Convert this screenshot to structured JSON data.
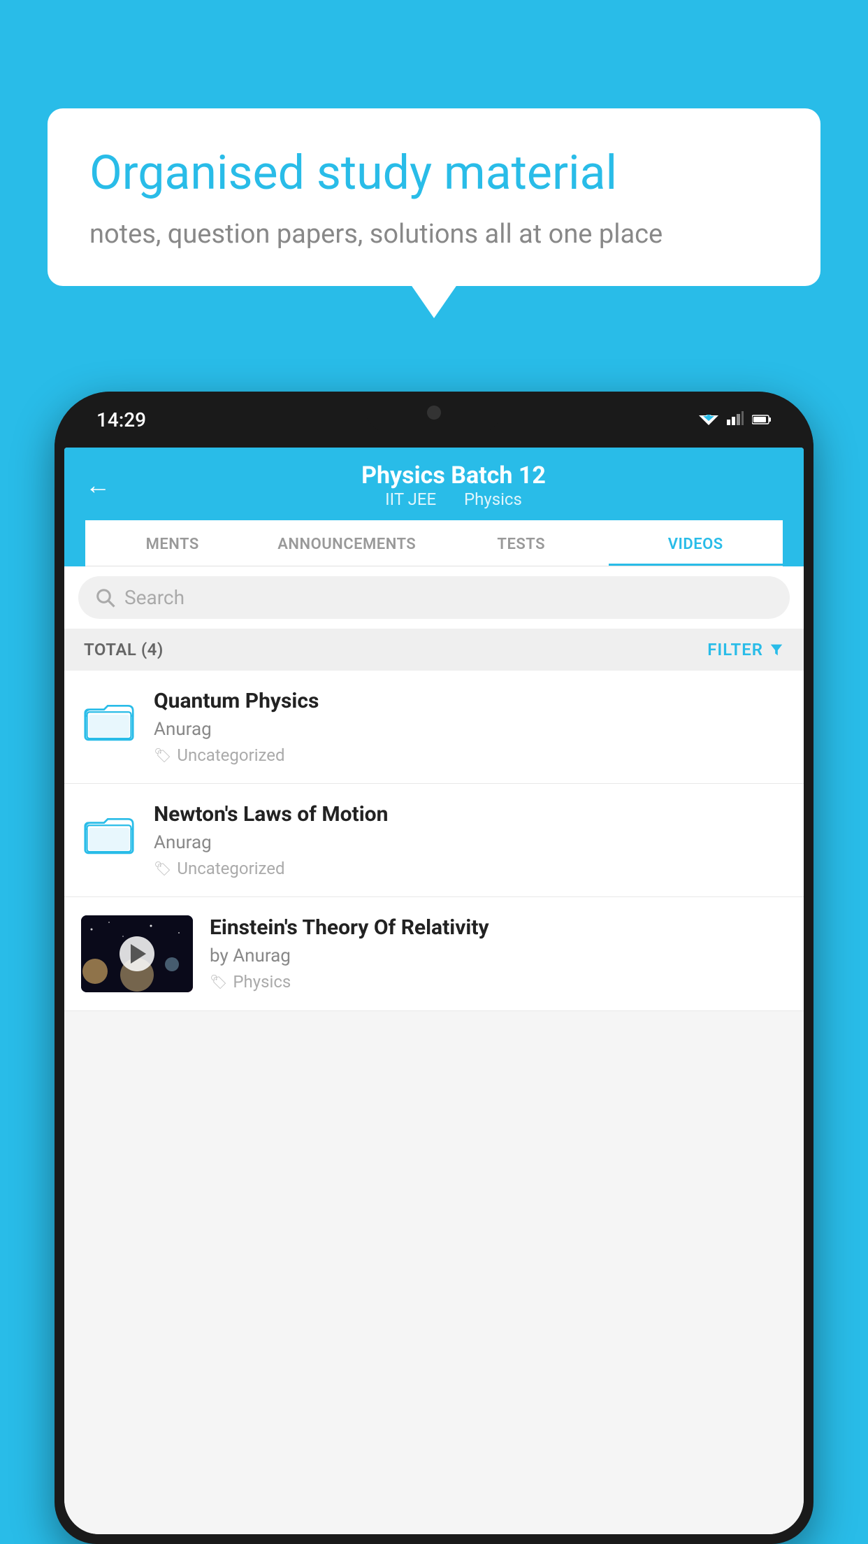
{
  "background_color": "#29bce8",
  "speech_bubble": {
    "title": "Organised study material",
    "subtitle": "notes, question papers, solutions all at one place"
  },
  "phone": {
    "status_bar": {
      "time": "14:29",
      "wifi": "▼▲",
      "signal": "▲",
      "battery": "▮"
    },
    "header": {
      "back_label": "←",
      "title": "Physics Batch 12",
      "subtitle_part1": "IIT JEE",
      "subtitle_part2": "Physics"
    },
    "tabs": [
      {
        "label": "MENTS",
        "active": false
      },
      {
        "label": "ANNOUNCEMENTS",
        "active": false
      },
      {
        "label": "TESTS",
        "active": false
      },
      {
        "label": "VIDEOS",
        "active": true
      }
    ],
    "search": {
      "placeholder": "Search"
    },
    "filter_bar": {
      "total_label": "TOTAL (4)",
      "filter_label": "FILTER"
    },
    "video_items": [
      {
        "title": "Quantum Physics",
        "author": "Anurag",
        "tag": "Uncategorized",
        "type": "folder"
      },
      {
        "title": "Newton's Laws of Motion",
        "author": "Anurag",
        "tag": "Uncategorized",
        "type": "folder"
      },
      {
        "title": "Einstein's Theory Of Relativity",
        "author": "by Anurag",
        "tag": "Physics",
        "type": "video"
      }
    ]
  }
}
